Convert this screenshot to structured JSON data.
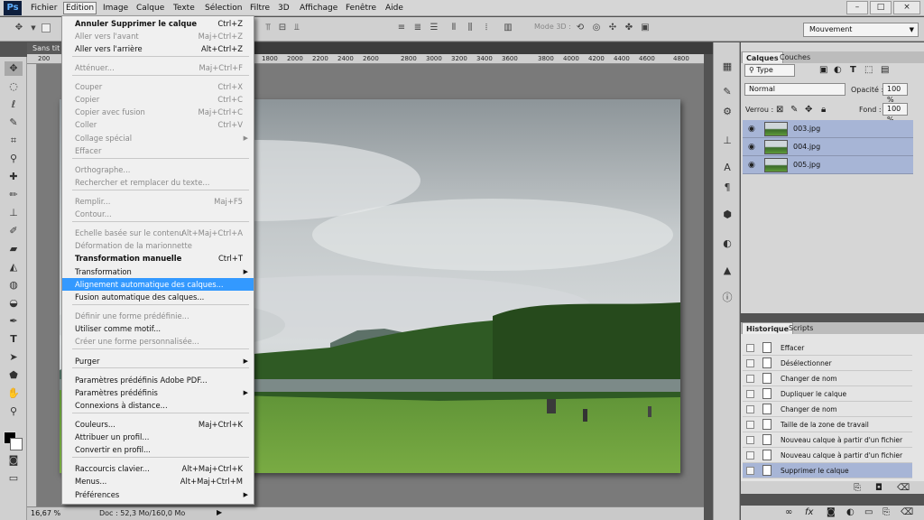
{
  "app": {
    "logo": "Ps"
  },
  "menubar": {
    "items": [
      "Fichier",
      "Edition",
      "Image",
      "Calque",
      "Texte",
      "Sélection",
      "Filtre",
      "3D",
      "Affichage",
      "Fenêtre",
      "Aide"
    ],
    "window_controls": [
      "–",
      "□",
      "×"
    ]
  },
  "options_bar": {
    "mode3d_label": "Mode 3D :",
    "workspace": "Mouvement"
  },
  "document_tab": {
    "title": "Sans tit"
  },
  "ruler": {
    "ticks": [
      "200",
      "1800",
      "2000",
      "2200",
      "2400",
      "2600",
      "2800",
      "3000",
      "3200",
      "3400",
      "3600",
      "3800",
      "4000",
      "4200",
      "4400",
      "4600",
      "4800"
    ]
  },
  "status": {
    "zoom": "16,67 %",
    "doc": "Doc : 52,3 Mo/160,0 Mo"
  },
  "edit_menu": {
    "items": [
      {
        "label": "Annuler Supprimer le calque",
        "shortcut": "Ctrl+Z",
        "disabled": false
      },
      {
        "label": "Aller vers l'avant",
        "shortcut": "Maj+Ctrl+Z",
        "disabled": true
      },
      {
        "label": "Aller vers l'arrière",
        "shortcut": "Alt+Ctrl+Z",
        "disabled": false
      },
      {
        "label": "Atténuer...",
        "shortcut": "Maj+Ctrl+F",
        "disabled": true
      },
      {
        "label": "Couper",
        "shortcut": "Ctrl+X",
        "disabled": true
      },
      {
        "label": "Copier",
        "shortcut": "Ctrl+C",
        "disabled": true
      },
      {
        "label": "Copier avec fusion",
        "shortcut": "Maj+Ctrl+C",
        "disabled": true
      },
      {
        "label": "Coller",
        "shortcut": "Ctrl+V",
        "disabled": true
      },
      {
        "label": "Collage spécial",
        "shortcut": "",
        "disabled": true
      },
      {
        "label": "Effacer",
        "shortcut": "",
        "disabled": true
      },
      {
        "label": "Orthographe...",
        "shortcut": "",
        "disabled": true
      },
      {
        "label": "Rechercher et remplacer du texte...",
        "shortcut": "",
        "disabled": true
      },
      {
        "label": "Remplir...",
        "shortcut": "Maj+F5",
        "disabled": true
      },
      {
        "label": "Contour...",
        "shortcut": "",
        "disabled": true
      },
      {
        "label": "Echelle basée sur le contenu",
        "shortcut": "Alt+Maj+Ctrl+A",
        "disabled": true
      },
      {
        "label": "Déformation de la marionnette",
        "shortcut": "",
        "disabled": true
      },
      {
        "label": "Transformation manuelle",
        "shortcut": "Ctrl+T",
        "disabled": false
      },
      {
        "label": "Transformation",
        "shortcut": "",
        "disabled": false
      },
      {
        "label": "Alignement automatique des calques...",
        "shortcut": "",
        "disabled": false
      },
      {
        "label": "Fusion automatique des calques...",
        "shortcut": "",
        "disabled": false
      },
      {
        "label": "Définir une forme prédéfinie...",
        "shortcut": "",
        "disabled": true
      },
      {
        "label": "Utiliser comme motif...",
        "shortcut": "",
        "disabled": false
      },
      {
        "label": "Créer une forme personnalisée...",
        "shortcut": "",
        "disabled": true
      },
      {
        "label": "Purger",
        "shortcut": "",
        "disabled": false
      },
      {
        "label": "Paramètres prédéfinis Adobe PDF...",
        "shortcut": "",
        "disabled": false
      },
      {
        "label": "Paramètres prédéfinis",
        "shortcut": "",
        "disabled": false
      },
      {
        "label": "Connexions à distance...",
        "shortcut": "",
        "disabled": false
      },
      {
        "label": "Couleurs...",
        "shortcut": "Maj+Ctrl+K",
        "disabled": false
      },
      {
        "label": "Attribuer un profil...",
        "shortcut": "",
        "disabled": false
      },
      {
        "label": "Convertir en profil...",
        "shortcut": "",
        "disabled": false
      },
      {
        "label": "Raccourcis clavier...",
        "shortcut": "Alt+Maj+Ctrl+K",
        "disabled": false
      },
      {
        "label": "Menus...",
        "shortcut": "Alt+Maj+Ctrl+M",
        "disabled": false
      },
      {
        "label": "Préférences",
        "shortcut": "",
        "disabled": false
      }
    ],
    "highlighted": "Alignement automatique des calques..."
  },
  "layers_panel": {
    "tabs": [
      "Calques",
      "Couches"
    ],
    "filter": "Type",
    "blend_mode": "Normal",
    "opacity_label": "Opacité :",
    "opacity": "100 %",
    "lock_label": "Verrou :",
    "fill_label": "Fond :",
    "fill": "100 %",
    "layers": [
      "003.jpg",
      "004.jpg",
      "005.jpg"
    ]
  },
  "history_panel": {
    "tabs": [
      "Historique",
      "Scripts"
    ],
    "items": [
      "Effacer",
      "Désélectionner",
      "Changer de nom",
      "Dupliquer le calque",
      "Changer de nom",
      "Taille de la zone de travail",
      "Nouveau calque à partir d'un fichier",
      "Nouveau calque à partir d'un fichier",
      "Supprimer le calque"
    ],
    "selected": "Supprimer le calque"
  }
}
